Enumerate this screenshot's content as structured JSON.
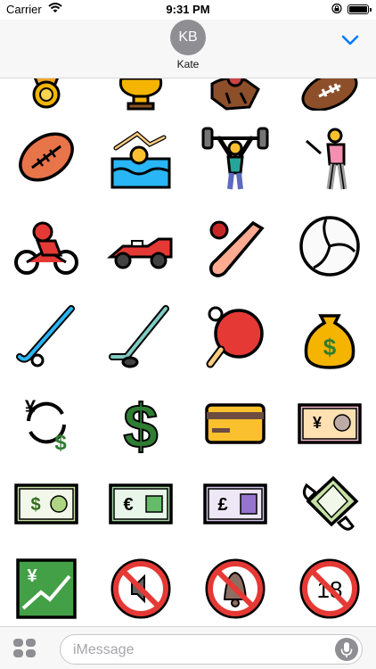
{
  "status_bar": {
    "carrier": "Carrier",
    "time": "9:31 PM"
  },
  "header": {
    "initials": "KB",
    "contact_name": "Kate"
  },
  "stickers": [
    [
      "sports-medal",
      "trophy",
      "horse-racing",
      "american-football"
    ],
    [
      "rugby-football",
      "person-swimming",
      "person-lifting-weights",
      "person-golfing"
    ],
    [
      "motorcycle-racer",
      "racing-car",
      "cricket-bat",
      "volleyball"
    ],
    [
      "field-hockey",
      "ice-hockey",
      "ping-pong",
      "money-bag"
    ],
    [
      "currency-exchange",
      "heavy-dollar-sign",
      "credit-card",
      "yen-banknote"
    ],
    [
      "dollar-banknote",
      "euro-banknote",
      "pound-banknote",
      "money-with-wings"
    ],
    [
      "chart-increasing-with-yen",
      "muted-speaker",
      "bell-with-slash",
      "no-one-under-eighteen"
    ]
  ],
  "sticker_text": {
    "dollar": "$",
    "yen": "¥",
    "euro": "€",
    "pound": "£",
    "eighteen": "18"
  },
  "compose": {
    "placeholder": "iMessage"
  },
  "colors": {
    "accent": "#007aff",
    "avatar_bg": "#8e8e93",
    "outline": "#000000"
  }
}
